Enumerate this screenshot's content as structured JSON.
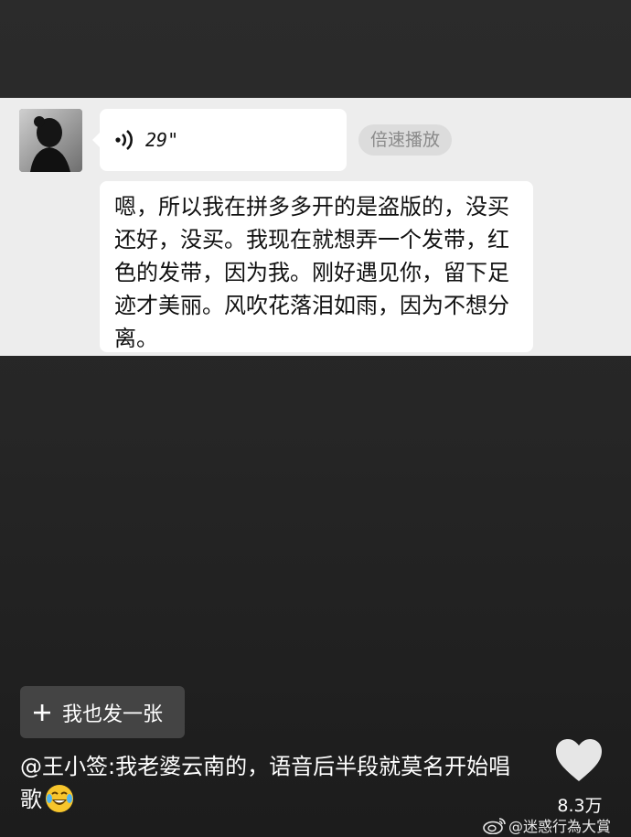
{
  "chat": {
    "voice_message": {
      "duration": "29\"",
      "icon": "sound-wave-icon"
    },
    "speed_play_label": "倍速播放",
    "transcript": "嗯，所以我在拼多多开的是盗版的，没买还好，没买。我现在就想弄一个发带，红色的发带，因为我。刚好遇见你，留下足迹才美丽。风吹花落泪如雨，因为不想分离。"
  },
  "post_button": {
    "icon": "plus-icon",
    "label": "我也发一张"
  },
  "caption": {
    "text": "@王小签:我老婆云南的，语音后半段就莫名开始唱歌",
    "emoji": "crying-laughing-emoji"
  },
  "like": {
    "icon": "heart-icon",
    "count": "8.3万"
  },
  "watermark": {
    "icon": "weibo-icon",
    "text": "@迷惑行為大賞"
  }
}
